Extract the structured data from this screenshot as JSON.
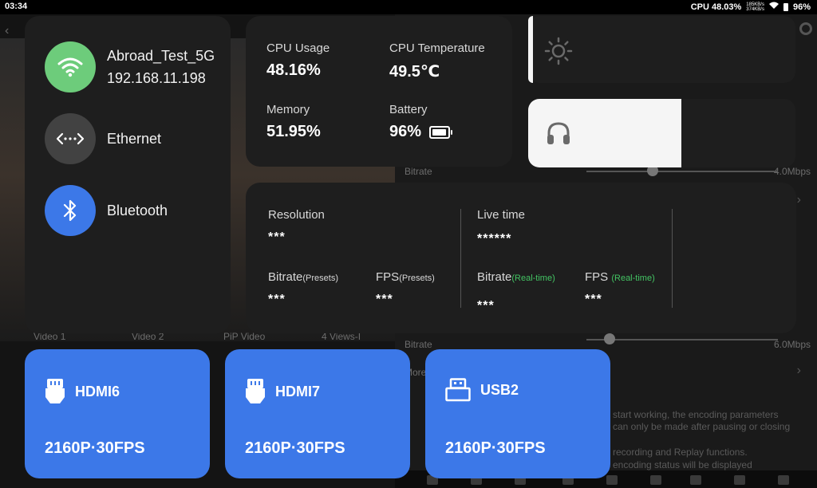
{
  "status_bar": {
    "time": "03:34",
    "cpu": "CPU 48.03%",
    "net_up": "185KB/s",
    "net_down": "374KB/s",
    "battery": "96%"
  },
  "background": {
    "tabs": [
      "Video 1",
      "Video 2",
      "PiP Video",
      "4 Views-I"
    ],
    "bitrate_label_1": "Bitrate",
    "bitrate_value_1": "4.0Mbps",
    "bitrate_label_2": "Bitrate",
    "bitrate_value_2": "6.0Mbps",
    "more_label": "More",
    "notes": [
      "start working, the encoding parameters",
      "can only be made after pausing or closing",
      "recording and Replay functions.",
      "encoding status will be displayed"
    ]
  },
  "network": {
    "wifi_ssid": "Abroad_Test_5G",
    "wifi_ip": "192.168.11.198",
    "ethernet_label": "Ethernet",
    "bluetooth_label": "Bluetooth",
    "colors": {
      "wifi": "#6dcc7b",
      "ethernet": "#424242",
      "bluetooth": "#3c78e8"
    }
  },
  "stats": {
    "cpu_usage_label": "CPU Usage",
    "cpu_usage_value": "48.16%",
    "cpu_temp_label": "CPU Temperature",
    "cpu_temp_value": "49.5℃",
    "memory_label": "Memory",
    "memory_value": "51.95%",
    "battery_label": "Battery",
    "battery_value": "96%",
    "battery_level": 0.96
  },
  "controls": {
    "brightness_icon": "sun-icon",
    "volume_icon": "headphones-icon",
    "brightness_level": 0.0,
    "volume_level": 0.57
  },
  "stream": {
    "resolution_label": "Resolution",
    "resolution_value": "***",
    "bitrate_label": "Bitrate",
    "bitrate_sub": "(Presets)",
    "bitrate_value": "***",
    "fps_label": "FPS",
    "fps_sub": "(Presets)",
    "fps_value": "***",
    "live_time_label": "Live time",
    "live_time_value": "******",
    "rt_bitrate_label": "Bitrate",
    "rt_bitrate_sub": "(Real-time)",
    "rt_bitrate_value": "***",
    "rt_fps_label": "FPS ",
    "rt_fps_sub": "(Real-time)",
    "rt_fps_value": "***"
  },
  "devices": [
    {
      "name": "HDMI6",
      "format": "2160P·30FPS",
      "icon": "hdmi-icon"
    },
    {
      "name": "HDMI7",
      "format": "2160P·30FPS",
      "icon": "hdmi-icon"
    },
    {
      "name": "USB2",
      "format": "2160P·30FPS",
      "icon": "usb-icon"
    }
  ],
  "accent_color": "#3c78e8"
}
